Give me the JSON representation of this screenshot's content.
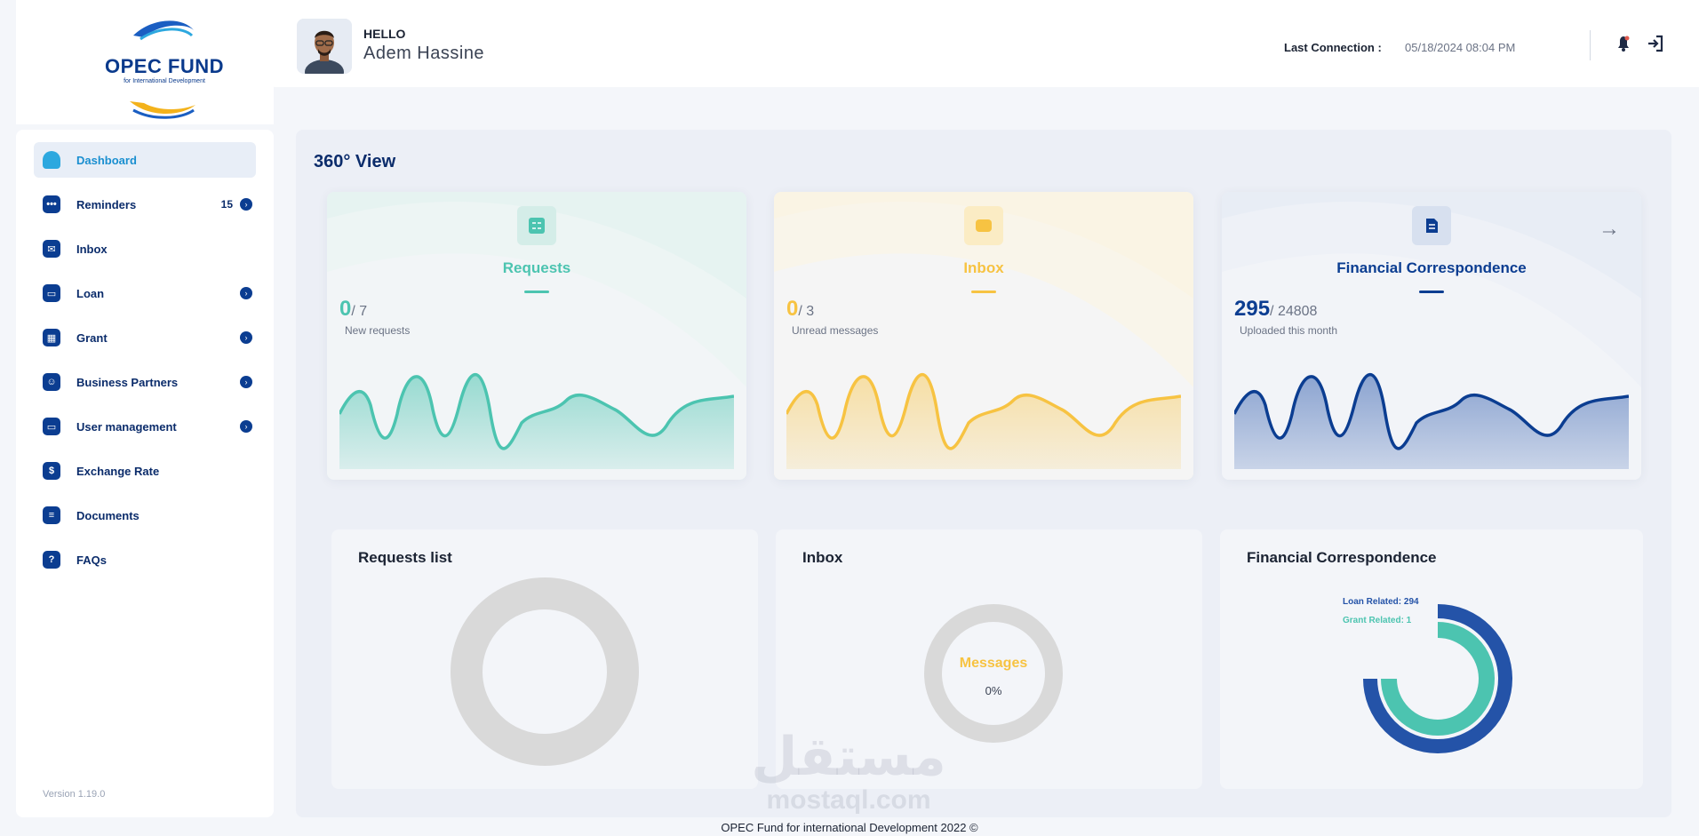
{
  "brand": {
    "name": "OPEC FUND",
    "tagline": "for International Development"
  },
  "sidebar": {
    "items": [
      {
        "label": "Dashboard",
        "icon": "home-icon",
        "active": true
      },
      {
        "label": "Reminders",
        "icon": "chat-icon",
        "count": "15",
        "arrow": true
      },
      {
        "label": "Inbox",
        "icon": "mail-icon"
      },
      {
        "label": "Loan",
        "icon": "wallet-icon",
        "arrow": true
      },
      {
        "label": "Grant",
        "icon": "calendar-icon",
        "arrow": true
      },
      {
        "label": "Business Partners",
        "icon": "users-icon",
        "arrow": true
      },
      {
        "label": "User management",
        "icon": "wallet-icon",
        "arrow": true
      },
      {
        "label": "Exchange Rate",
        "icon": "exchange-icon"
      },
      {
        "label": "Documents",
        "icon": "document-icon"
      },
      {
        "label": "FAQs",
        "icon": "question-icon"
      }
    ],
    "version": "Version 1.19.0"
  },
  "header": {
    "greeting": "HELLO",
    "user_name": "Adem  Hassine",
    "last_connection_label": "Last Connection :",
    "last_connection_value": "05/18/2024 08:04 PM"
  },
  "main": {
    "title": "360° View",
    "stats": [
      {
        "title": "Requests",
        "value": "0",
        "total": "/ 7",
        "desc": "New requests",
        "color": "#4cc4b0"
      },
      {
        "title": "Inbox",
        "value": "0",
        "total": "/ 3",
        "desc": "Unread messages",
        "color": "#f7c342"
      },
      {
        "title": "Financial Correspondence",
        "value": "295",
        "total": "/ 24808",
        "desc": "Uploaded this month",
        "color": "#0b3d91"
      }
    ],
    "bottom": {
      "requests_title": "Requests list",
      "inbox_title": "Inbox",
      "inbox_center_label": "Messages",
      "inbox_center_value": "0%",
      "financial_title": "Financial Correspondence",
      "legend": [
        {
          "label": "Loan Related: 294",
          "color": "#2453a8"
        },
        {
          "label": "Grant Related: 1",
          "color": "#4cc4b0"
        }
      ]
    }
  },
  "chart_data": [
    {
      "type": "donut",
      "title": "Inbox",
      "center_label": "Messages",
      "center_value": "0%"
    },
    {
      "type": "donut",
      "title": "Financial Correspondence",
      "series": [
        {
          "name": "Loan Related",
          "values": [
            294
          ]
        },
        {
          "name": "Grant Related",
          "values": [
            1
          ]
        }
      ]
    }
  ],
  "footer": {
    "text": "OPEC Fund for international Development 2022 ©"
  },
  "watermark": {
    "arabic": "مستقل",
    "latin": "mostaql.com"
  }
}
